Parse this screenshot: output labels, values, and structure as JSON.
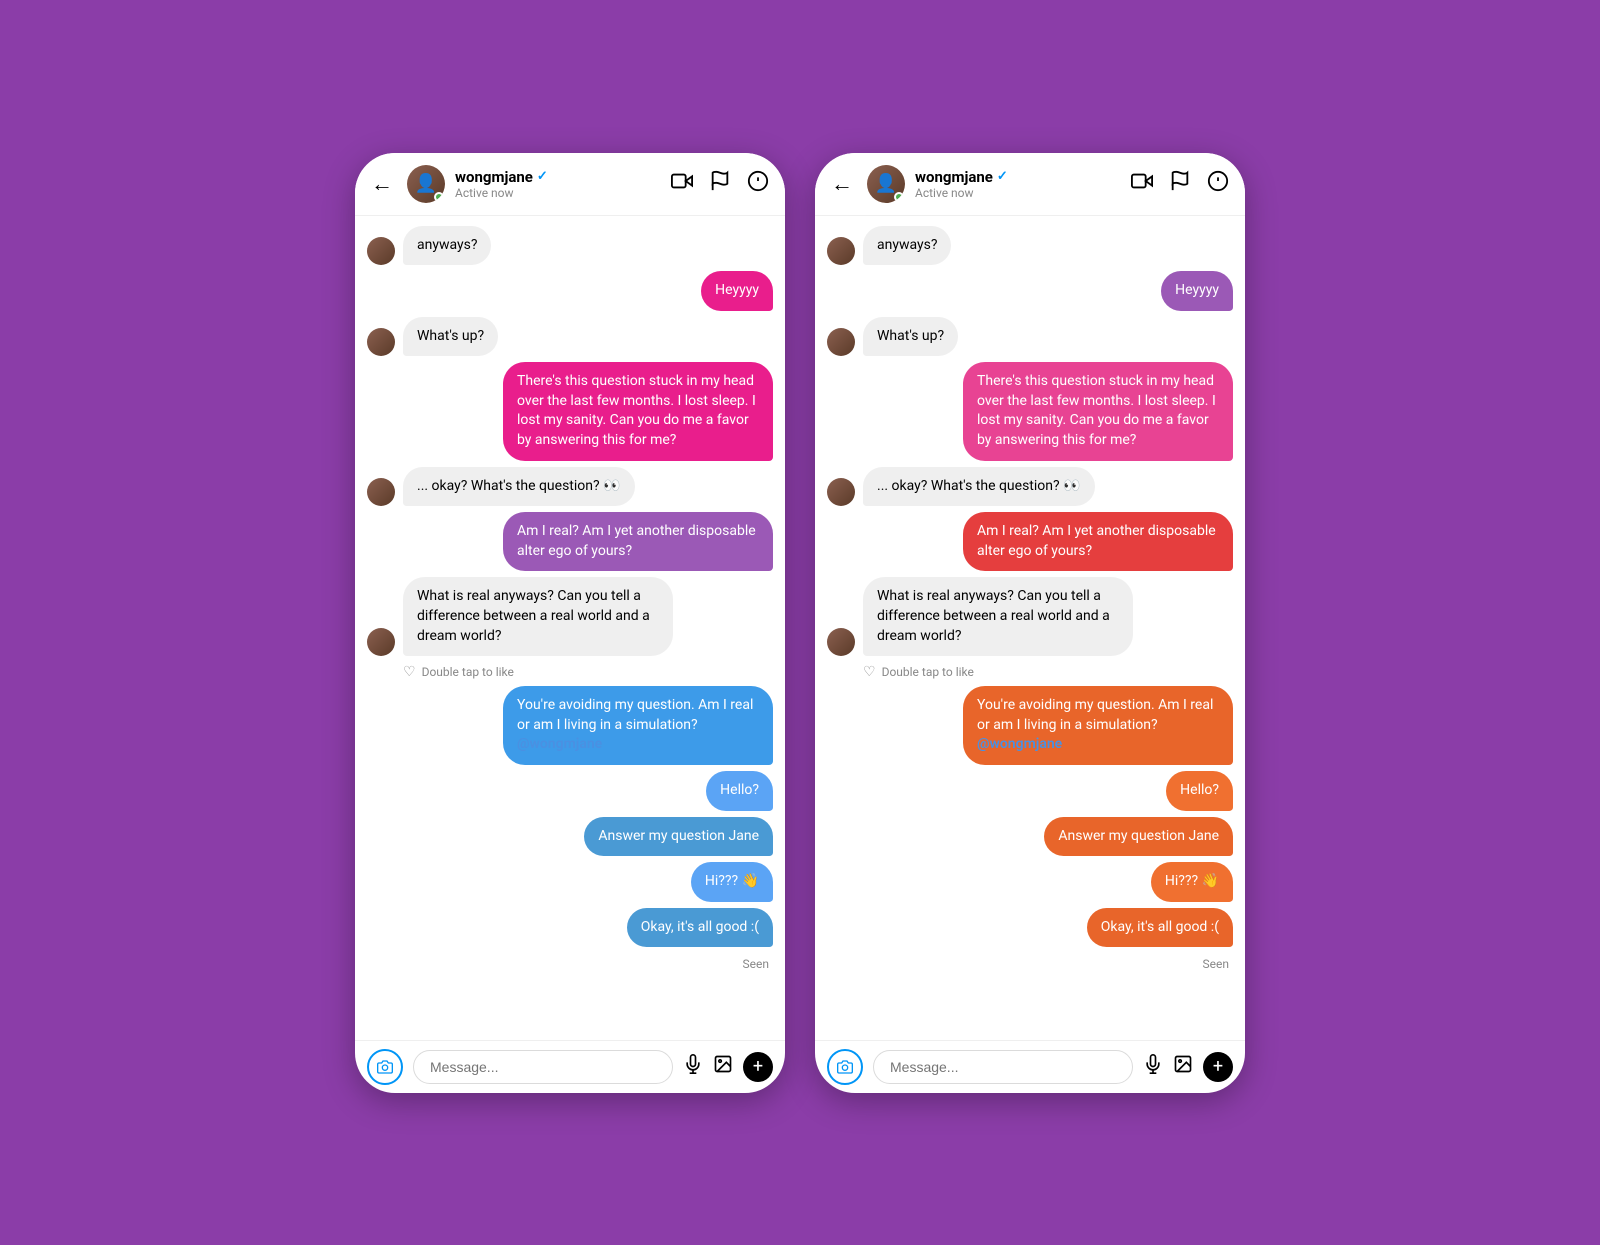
{
  "phones": [
    {
      "id": "left",
      "header": {
        "back_label": "←",
        "username": "wongmjane",
        "verified": "✓",
        "status": "Active now",
        "video_icon": "📹",
        "flag_icon": "⚑",
        "info_icon": "ⓘ"
      },
      "messages": [
        {
          "id": "m1",
          "type": "received",
          "text": "anyways?",
          "show_avatar": true
        },
        {
          "id": "m2",
          "type": "sent",
          "text": "Heyyyy",
          "color": "sent-pink"
        },
        {
          "id": "m3",
          "type": "received",
          "text": "What's up?",
          "show_avatar": true
        },
        {
          "id": "m4",
          "type": "sent",
          "text": "There's this question stuck in my head over the last few months. I lost sleep. I lost my sanity. Can you do me a favor by answering this for me?",
          "color": "sent-pink"
        },
        {
          "id": "m5",
          "type": "received",
          "text": "... okay? What's the question? 👀",
          "show_avatar": true
        },
        {
          "id": "m6",
          "type": "sent",
          "text": "Am I real? Am I yet another disposable alter ego of yours?",
          "color": "sent-purple"
        },
        {
          "id": "m7",
          "type": "received",
          "text": "What is real anyways? Can you tell a difference between a real world and a dream world?",
          "show_avatar": true,
          "double_tap": true
        },
        {
          "id": "m8",
          "type": "sent",
          "text": "You're avoiding my question. Am I real or am I living in a simulation?\n@wongmjane",
          "color": "sent-blue",
          "mention": "@wongmjane"
        },
        {
          "id": "m9",
          "type": "sent",
          "text": "Hello?",
          "color": "sent-blue2"
        },
        {
          "id": "m10",
          "type": "sent",
          "text": "Answer my question Jane",
          "color": "sent-blue3"
        },
        {
          "id": "m11",
          "type": "sent",
          "text": "Hi??? 👋",
          "color": "sent-blue2"
        },
        {
          "id": "m12",
          "type": "sent",
          "text": "Okay, it's all good :(",
          "color": "sent-blue3"
        }
      ],
      "seen": "Seen",
      "input_placeholder": "Message...",
      "double_tap_label": "Double tap to like"
    },
    {
      "id": "right",
      "header": {
        "back_label": "←",
        "username": "wongmjane",
        "verified": "✓",
        "status": "Active now",
        "video_icon": "📹",
        "flag_icon": "⚑",
        "info_icon": "ⓘ"
      },
      "messages": [
        {
          "id": "r1",
          "type": "received",
          "text": "anyways?",
          "show_avatar": true
        },
        {
          "id": "r2",
          "type": "sent",
          "text": "Heyyyy",
          "color": "sent-purple"
        },
        {
          "id": "r3",
          "type": "received",
          "text": "What's up?",
          "show_avatar": true
        },
        {
          "id": "r4",
          "type": "sent",
          "text": "There's this question stuck in my head over the last few months. I lost sleep. I lost my sanity. Can you do me a favor by answering this for me?",
          "color": "sent-pink-right"
        },
        {
          "id": "r5",
          "type": "received",
          "text": "... okay? What's the question? 👀",
          "show_avatar": true
        },
        {
          "id": "r6",
          "type": "sent",
          "text": "Am I real? Am I yet another disposable alter ego of yours?",
          "color": "sent-red"
        },
        {
          "id": "r7",
          "type": "received",
          "text": "What is real anyways? Can you tell a difference between a real world and a dream world?",
          "show_avatar": true,
          "double_tap": true
        },
        {
          "id": "r8",
          "type": "sent",
          "text": "You're avoiding my question. Am I real or am I living in a simulation?\n@wongmjane",
          "color": "sent-orange",
          "mention": "@wongmjane"
        },
        {
          "id": "r9",
          "type": "sent",
          "text": "Hello?",
          "color": "sent-orange2"
        },
        {
          "id": "r10",
          "type": "sent",
          "text": "Answer my question Jane",
          "color": "sent-orange"
        },
        {
          "id": "r11",
          "type": "sent",
          "text": "Hi??? 👋",
          "color": "sent-orange2"
        },
        {
          "id": "r12",
          "type": "sent",
          "text": "Okay, it's all good :(",
          "color": "sent-orange"
        }
      ],
      "seen": "Seen",
      "input_placeholder": "Message...",
      "double_tap_label": "Double tap to like"
    }
  ]
}
